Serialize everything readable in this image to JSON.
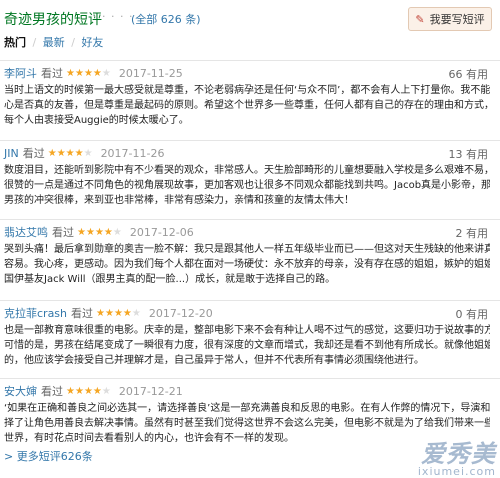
{
  "header": {
    "title": "奇迹男孩的短评",
    "dots": "· · · · · ·",
    "all_count": "(全部 626 条)",
    "write_button": "我要写短评"
  },
  "tabs": {
    "hot": "热门",
    "new": "最新",
    "friends": "好友",
    "sep": "/"
  },
  "reviews": [
    {
      "user": "李阿斗",
      "seen": "看过",
      "rating": 4,
      "date": "2017-11-25",
      "useful": "66 有用",
      "lines": [
        "当时上语文的时候第一最大感受就是尊重，不论老弱病孕还是任何‘与众不同’，都不会有人上下打量你。我不能说他们内",
        "心是否真的友善，但是尊重是最起码的原则。希望这个世界多一些尊重，任何人都有自己的存在的理由和方式，看到",
        "每个人由衷接受Auggie的时候太暖心了。"
      ]
    },
    {
      "user": "JIN",
      "seen": "看过",
      "rating": 4,
      "date": "2017-11-26",
      "useful": "13 有用",
      "lines": [
        "数度泪目，还能听到影院中有不少看哭的观众，非常感人。天生脸部畸形的儿童想要融入学校是多么艰难不易，影片",
        "很赞的一点是通过不同角色的视角展现故事，更加客观也让很多不同观众都能找到共鸣。Jacob真是小影帝，那段和",
        "男孩的冲突很棒，来到亚也非常棒，非常有感染力，亲情和孩童的友情太伟大！"
      ]
    },
    {
      "user": "翡达艾鸣",
      "seen": "看过",
      "rating": 4,
      "date": "2017-12-06",
      "useful": "2 有用",
      "lines": [
        "哭到头痛！最后拿到勋章的奥吉一脸不解：我只是跟其他人一样五年级毕业而已——但这对天生残缺的他来讲真的不",
        "容易。我心疼，更感动。因为我们每个人都在面对一场硬仗：永不放弃的母亲，没有存在感的姐姐，嫉妒的姐姐闺蜜，英",
        "国伊基友Jack Will（跟男主真的配一脸...）成长，就是敢于选择自己的路。"
      ]
    },
    {
      "user": "克拉菲crash",
      "seen": "看过",
      "rating": 4,
      "date": "2017-12-20",
      "useful": "0 有用",
      "lines": [
        "也是一部教育意味很重的电影。庆幸的是，整部电影下来不会有种让人喝不过气的感觉，这要归功于说故事的方式。",
        "可惜的是，男孩在结尾变成了一瞬很有力度，很有深度的文章而增式，我却还是看不到他有所成长。就像他姐姐组说",
        "的，他应该学会接受自己并理解才是，自己虽异于常人，但并不代表所有事情必须围绕他进行。"
      ]
    },
    {
      "user": "安大婶",
      "seen": "看过",
      "rating": 4,
      "date": "2017-12-21",
      "useful": "",
      "lines": [
        "‘如果在正确和善良之间必选其一，请选择善良’这是一部充满善良和反思的电影。在有人作弊的情况下，导演和编剧选",
        "择了让角色用善良去解决事情。虽然有时甚至我们觉得这世界不会这么完美，但电影不就是为了给我们带来一些美好的",
        "世界，有时花点时间去看看别人的内心，也许会有不一样的发现。"
      ]
    }
  ],
  "more_link": "> 更多短评626条",
  "watermark": {
    "big": "爱秀美",
    "small": "ixiumei.com"
  },
  "colors": {
    "title": "#007722",
    "link": "#3377aa",
    "star": "#f5a623"
  }
}
